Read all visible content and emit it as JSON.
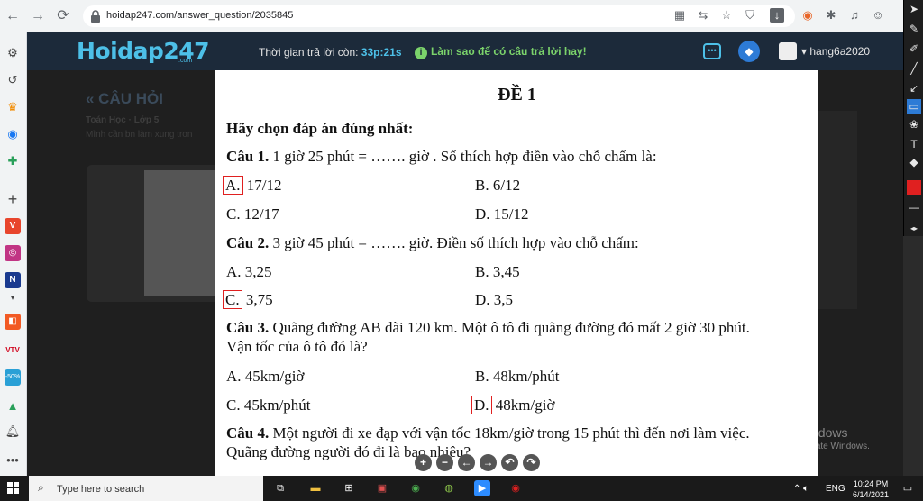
{
  "browser": {
    "url": "hoidap247.com/answer_question/2035845",
    "back_icon": "←",
    "forward_icon": "→",
    "reload_icon": "⟳"
  },
  "header": {
    "logo": "Hoidap247",
    "logo_sub": ".com",
    "timer_label": "Thời gian trả lời còn:",
    "timer_value": "33p:21s",
    "tip": "Làm sao để có câu trả lời hay!",
    "username": "hang6a2020"
  },
  "background_page": {
    "heading": "« CÂU HỎI",
    "subject": "Toán Học · Lớp 5",
    "question_text": "Mình cần bn làm xung tron"
  },
  "worksheet": {
    "title": "ĐỀ 1",
    "instruction": "Hãy chọn đáp án đúng nhất:",
    "questions": [
      {
        "label": "Câu 1.",
        "text": " 1 giờ 25 phút = ……. giờ . Số thích hợp điền vào chỗ chấm là:",
        "options": [
          {
            "letter": "A.",
            "text": " 17/12"
          },
          {
            "letter": "B.",
            "text": " 6/12"
          },
          {
            "letter": "C.",
            "text": " 12/17"
          },
          {
            "letter": "D.",
            "text": " 15/12"
          }
        ]
      },
      {
        "label": "Câu 2.",
        "text": " 3 giờ 45 phút = ……. giờ. Điền số thích hợp vào chỗ chấm:",
        "options": [
          {
            "letter": "A.",
            "text": " 3,25"
          },
          {
            "letter": "B.",
            "text": " 3,45"
          },
          {
            "letter": "C.",
            "text": " 3,75"
          },
          {
            "letter": "D.",
            "text": " 3,5"
          }
        ]
      },
      {
        "label": "Câu 3.",
        "text": " Quãng đường AB dài 120 km. Một ô tô đi quãng đường đó mất 2 giờ 30 phút.",
        "text2": "Vận tốc của ô tô đó là?",
        "options": [
          {
            "letter": "A.",
            "text": " 45km/giờ"
          },
          {
            "letter": "B.",
            "text": " 48km/phút"
          },
          {
            "letter": "C.",
            "text": " 45km/phút"
          },
          {
            "letter": "D.",
            "text": " 48km/giờ"
          }
        ]
      },
      {
        "label": "Câu 4.",
        "text": " Một người đi xe đạp với vận tốc 18km/giờ trong 15 phút thì đến nơi làm việc.",
        "text2": "Quãng đường người đó đi là bao nhiêu?"
      }
    ]
  },
  "activation": {
    "line1": "Activate Windows",
    "line2": "Go to Settings to activate Windows."
  },
  "taskbar": {
    "search_placeholder": "Type here to search",
    "language": "ENG",
    "time": "10:24 PM",
    "date": "6/14/2021"
  },
  "colors": {
    "header_bg": "#1c2a3a",
    "accent": "#4dc0e8",
    "tip_green": "#7bd36b",
    "selected_red": "#e02020"
  }
}
